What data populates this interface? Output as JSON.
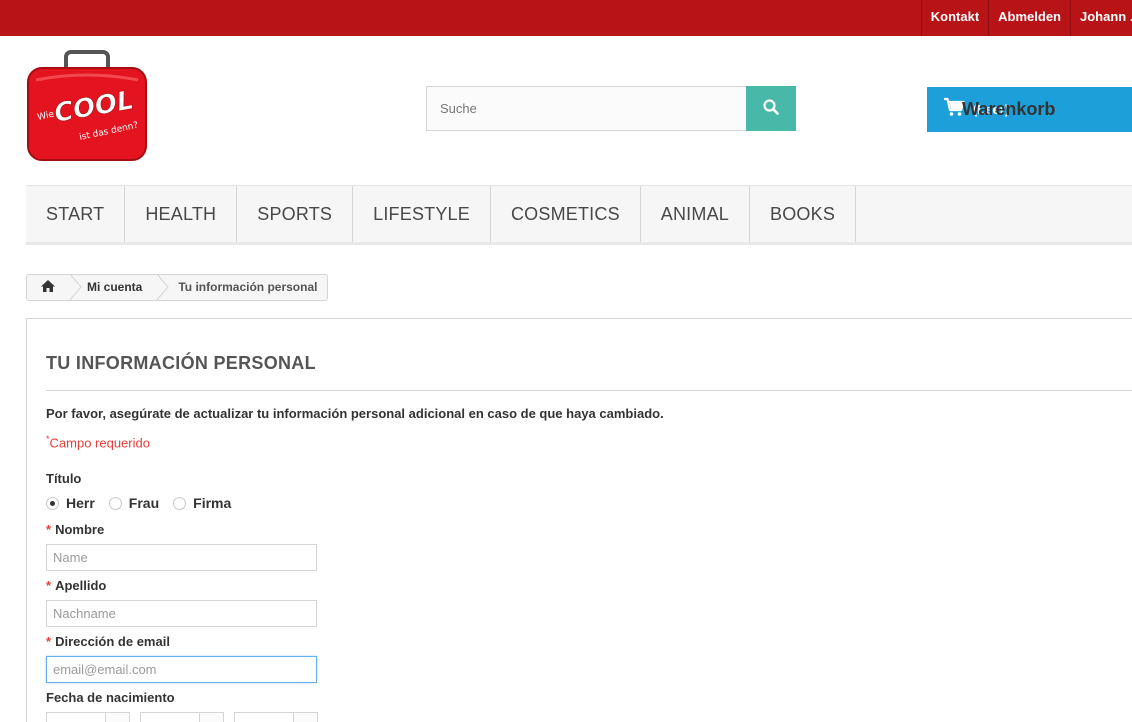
{
  "topbar": {
    "links": [
      "Kontakt",
      "Abmelden",
      "Johann ..."
    ]
  },
  "logo": {
    "alt": "Wie COOL ist das denn?",
    "brand_color": "#e3141f"
  },
  "search": {
    "placeholder": "Suche",
    "icon": "search-icon"
  },
  "cart": {
    "label": "Warenkorb",
    "count": "(Leer)",
    "icon": "cart-icon"
  },
  "menu": {
    "items": [
      "START",
      "HEALTH",
      "SPORTS",
      "LIFESTYLE",
      "COSMETICS",
      "ANIMAL",
      "BOOKS"
    ]
  },
  "breadcrumb": {
    "home_icon": "home-icon",
    "account": "Mi cuenta",
    "current": "Tu información personal"
  },
  "form": {
    "heading": "TU INFORMACIÓN PERSONAL",
    "intro": "Por favor, asegúrate de actualizar tu información personal adicional en caso de que haya cambiado.",
    "required_mark": "*",
    "required_note": "Campo requerido",
    "title_label": "Título",
    "title_options": [
      "Herr",
      "Frau",
      "Firma"
    ],
    "title_selected": "Herr",
    "firstname_label": "Nombre",
    "firstname_placeholder": "Name",
    "lastname_label": "Apellido",
    "lastname_placeholder": "Nachname",
    "email_label": "Dirección de email",
    "email_placeholder": "email@email.com",
    "birthdate_label": "Fecha de nacimiento"
  },
  "colors": {
    "topbar": "#b81417",
    "search_button": "#48b8a8",
    "cart": "#1da0da",
    "required": "#e3403a"
  }
}
